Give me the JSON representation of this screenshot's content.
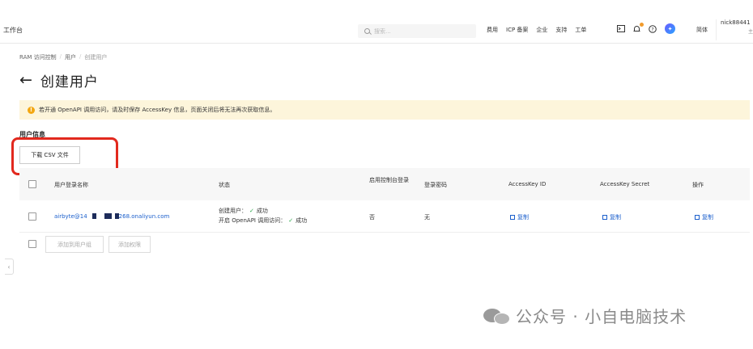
{
  "topbar": {
    "brand": "工作台",
    "search_placeholder": "搜索...",
    "nav_links": [
      "费用",
      "ICP 备案",
      "企业",
      "支持",
      "工单"
    ],
    "lang": "简体",
    "user_name": "nick88441",
    "user_role": "主"
  },
  "breadcrumb": [
    "RAM 访问控制",
    "用户",
    "创建用户"
  ],
  "page": {
    "title": "创建用户",
    "back_arrow": "←"
  },
  "banner": {
    "text": "若开通 OpenAPI 调用访问，请及时保存 AccessKey 信息，页面关闭后将无法再次获取信息。"
  },
  "section_label": "用户信息",
  "download_button": "下载 CSV 文件",
  "table": {
    "headers": [
      "用户登录名称",
      "状态",
      "启用控制台登录",
      "登录密码",
      "AccessKey ID",
      "AccessKey Secret",
      "操作"
    ],
    "rows": [
      {
        "login_prefix": "airbyte@14",
        "login_suffix": "268.onaliyun.com",
        "status_line1_label": "创建用户：",
        "status_line1_value": "成功",
        "status_line2_label": "开启 OpenAPI 调用访问：",
        "status_line2_value": "成功",
        "console_login": "否",
        "password": "无",
        "ak_id_action": "复制",
        "ak_secret_action": "复制",
        "op_action": "复制"
      }
    ]
  },
  "footer": {
    "add_to_group": "添加到用户组",
    "add_permission": "添加权限"
  },
  "watermark": "公众号 · 小自电脑技术"
}
